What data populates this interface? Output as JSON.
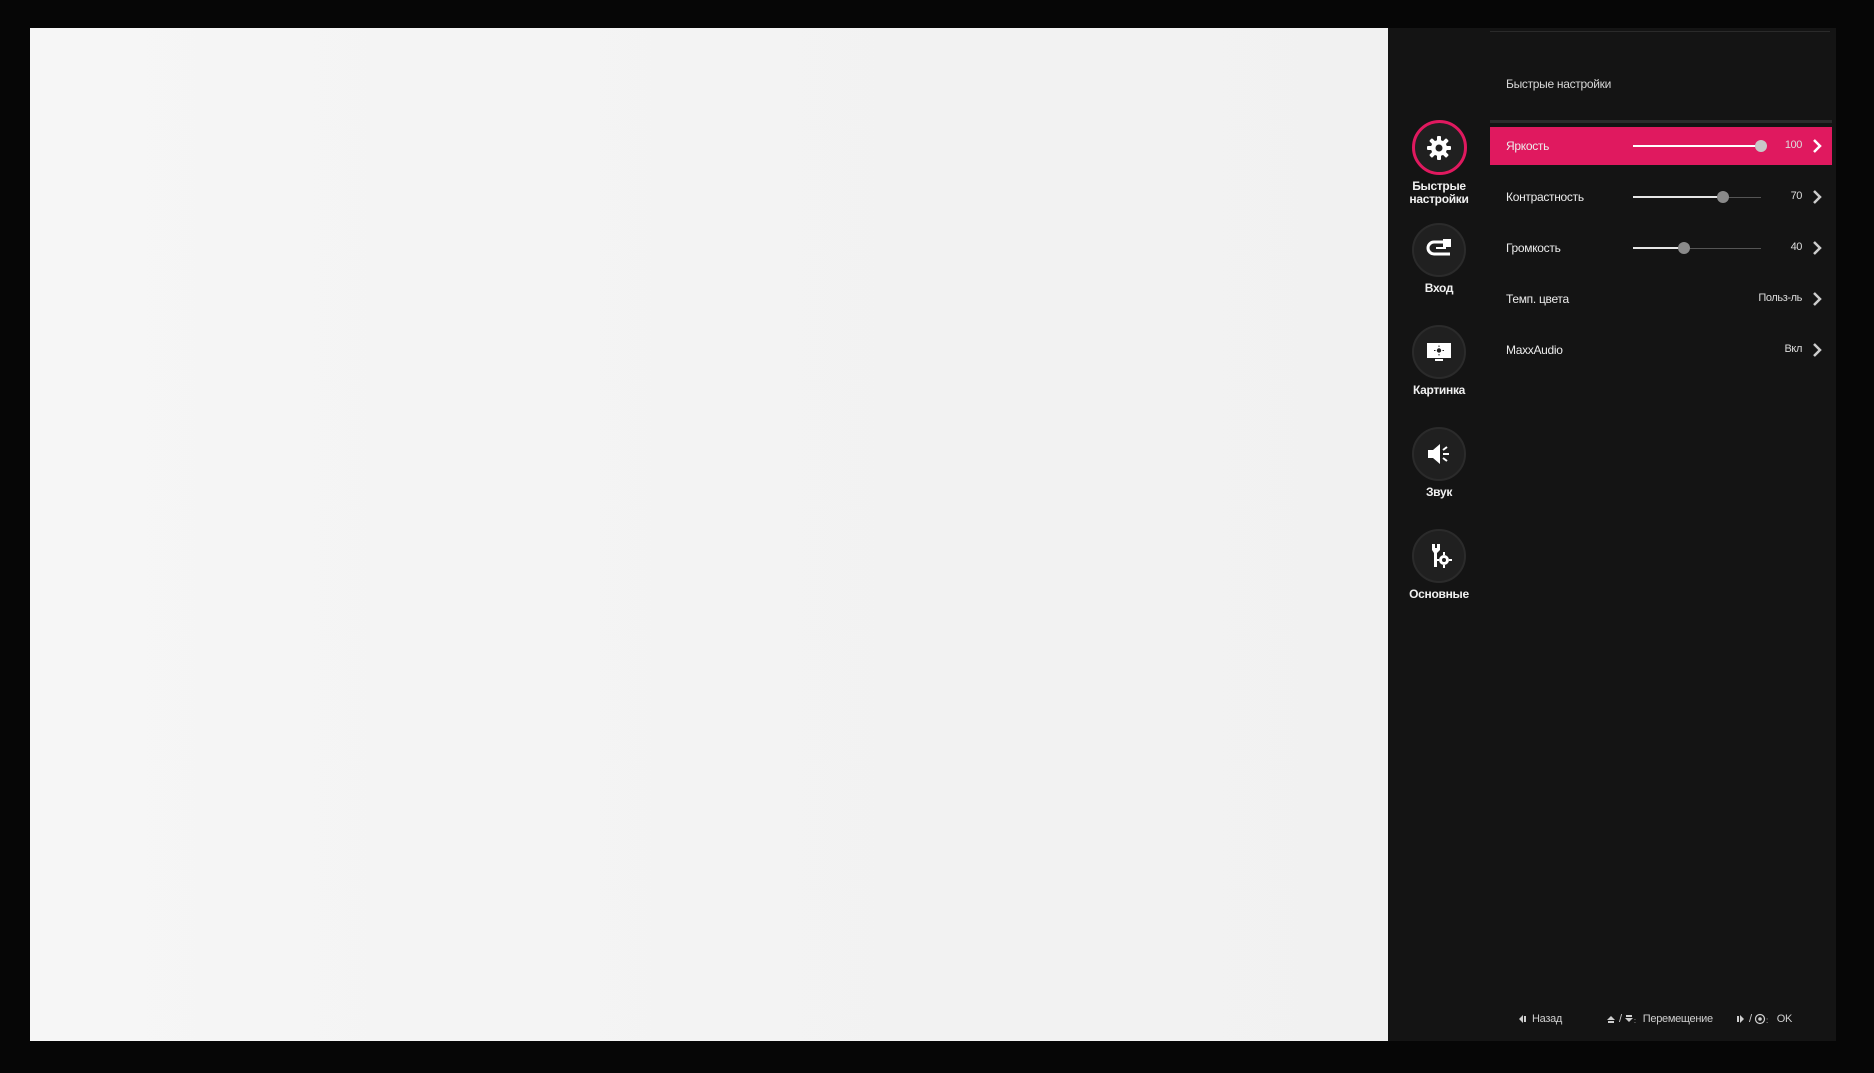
{
  "colors": {
    "accent": "#e0195f",
    "panel_bg": "#141414",
    "screen_bg": "#f4f4f4"
  },
  "rail": [
    {
      "label_line1": "Быстрые",
      "label_line2": "настройки",
      "icon": "gear-icon",
      "active": true
    },
    {
      "label_line1": "Вход",
      "label_line2": "",
      "icon": "input-icon",
      "active": false
    },
    {
      "label_line1": "Картинка",
      "label_line2": "",
      "icon": "picture-icon",
      "active": false
    },
    {
      "label_line1": "Звук",
      "label_line2": "",
      "icon": "speaker-icon",
      "active": false
    },
    {
      "label_line1": "Основные",
      "label_line2": "",
      "icon": "wrench-gear-icon",
      "active": false
    }
  ],
  "panel": {
    "title": "Быстрые настройки",
    "rows": [
      {
        "label": "Яркость",
        "value": "100",
        "slider": 100,
        "active": true
      },
      {
        "label": "Контрастность",
        "value": "70",
        "slider": 70,
        "active": false
      },
      {
        "label": "Громкость",
        "value": "40",
        "slider": 40,
        "active": false
      },
      {
        "label": "Темп. цвета",
        "value": "Польз-ль",
        "active": false
      },
      {
        "label": "MaxxAudio",
        "value": "Вкл",
        "active": false
      }
    ]
  },
  "footer": {
    "back": "Назад",
    "move_sep": "/",
    "move": "Перемещение",
    "ok_sep": "/",
    "ok": "OK"
  }
}
